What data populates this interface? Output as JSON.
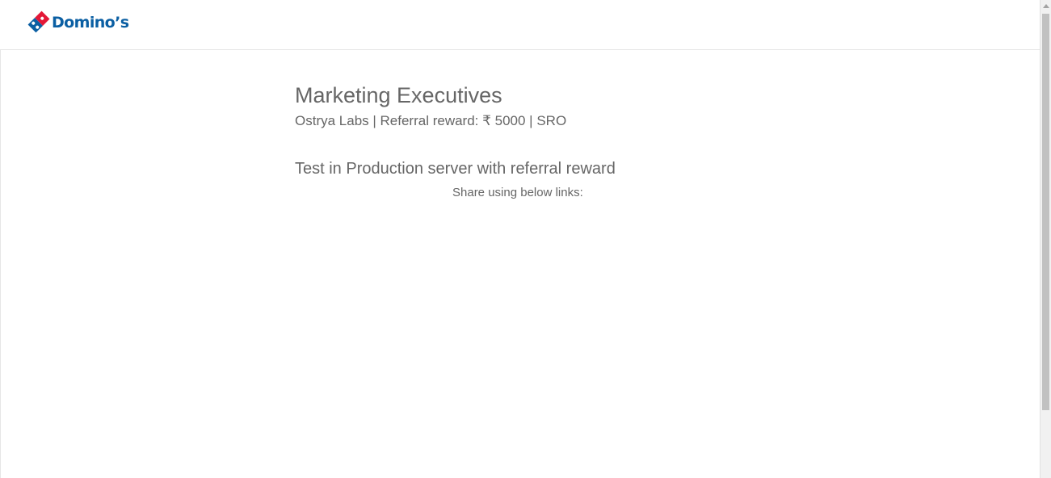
{
  "header": {
    "brand_name": "Domino’s",
    "logo_icon": "dominos-tile-icon",
    "brand_color": "#0b5fa3",
    "accent_color": "#e31837"
  },
  "job": {
    "title": "Marketing Executives",
    "meta": "Ostrya Labs | Referral reward: ₹ 5000 | SRO",
    "description": "Test in Production server with referral reward",
    "share_label": "Share using below links:"
  }
}
